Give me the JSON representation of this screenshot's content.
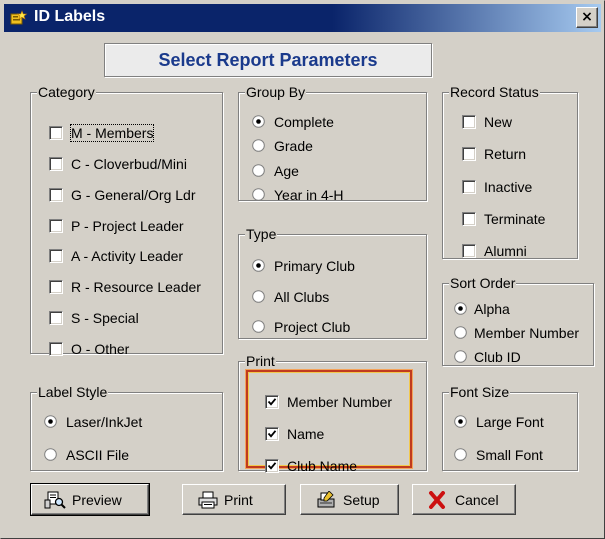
{
  "window": {
    "title": "ID Labels",
    "close_label": "×"
  },
  "header": {
    "title": "Select Report Parameters"
  },
  "category": {
    "legend": "Category",
    "items": [
      {
        "label": "M - Members",
        "checked": false
      },
      {
        "label": "C - Cloverbud/Mini",
        "checked": false
      },
      {
        "label": "G - General/Org Ldr",
        "checked": false
      },
      {
        "label": "P - Project Leader",
        "checked": false
      },
      {
        "label": "A - Activity Leader",
        "checked": false
      },
      {
        "label": "R - Resource Leader",
        "checked": false
      },
      {
        "label": "S - Special",
        "checked": false
      },
      {
        "label": "O - Other",
        "checked": false
      }
    ]
  },
  "group_by": {
    "legend": "Group By",
    "options": [
      "Complete",
      "Grade",
      "Age",
      "Year in 4-H"
    ],
    "selected": "Complete"
  },
  "type": {
    "legend": "Type",
    "options": [
      "Primary Club",
      "All Clubs",
      "Project Club"
    ],
    "selected": "Primary Club"
  },
  "record_status": {
    "legend": "Record Status",
    "items": [
      {
        "label": "New",
        "checked": false
      },
      {
        "label": "Return",
        "checked": false
      },
      {
        "label": "Inactive",
        "checked": false
      },
      {
        "label": "Terminate",
        "checked": false
      },
      {
        "label": "Alumni",
        "checked": false
      }
    ]
  },
  "sort_order": {
    "legend": "Sort Order",
    "options": [
      "Alpha",
      "Member Number",
      "Club ID"
    ],
    "selected": "Alpha"
  },
  "label_style": {
    "legend": "Label Style",
    "options": [
      "Laser/InkJet",
      "ASCII File"
    ],
    "selected": "Laser/InkJet"
  },
  "print": {
    "legend": "Print",
    "items": [
      {
        "label": "Member Number",
        "checked": true
      },
      {
        "label": "Name",
        "checked": true
      },
      {
        "label": "Club Name",
        "checked": true
      }
    ]
  },
  "font_size": {
    "legend": "Font Size",
    "options": [
      "Large Font",
      "Small Font"
    ],
    "selected": "Large Font"
  },
  "buttons": {
    "preview": "Preview",
    "print": "Print",
    "setup": "Setup",
    "cancel": "Cancel"
  },
  "colors": {
    "title_bar": "#0a246a",
    "header_text": "#1a3a8c",
    "highlight_border": "#c03a1e",
    "cancel_icon": "#cc1010"
  }
}
